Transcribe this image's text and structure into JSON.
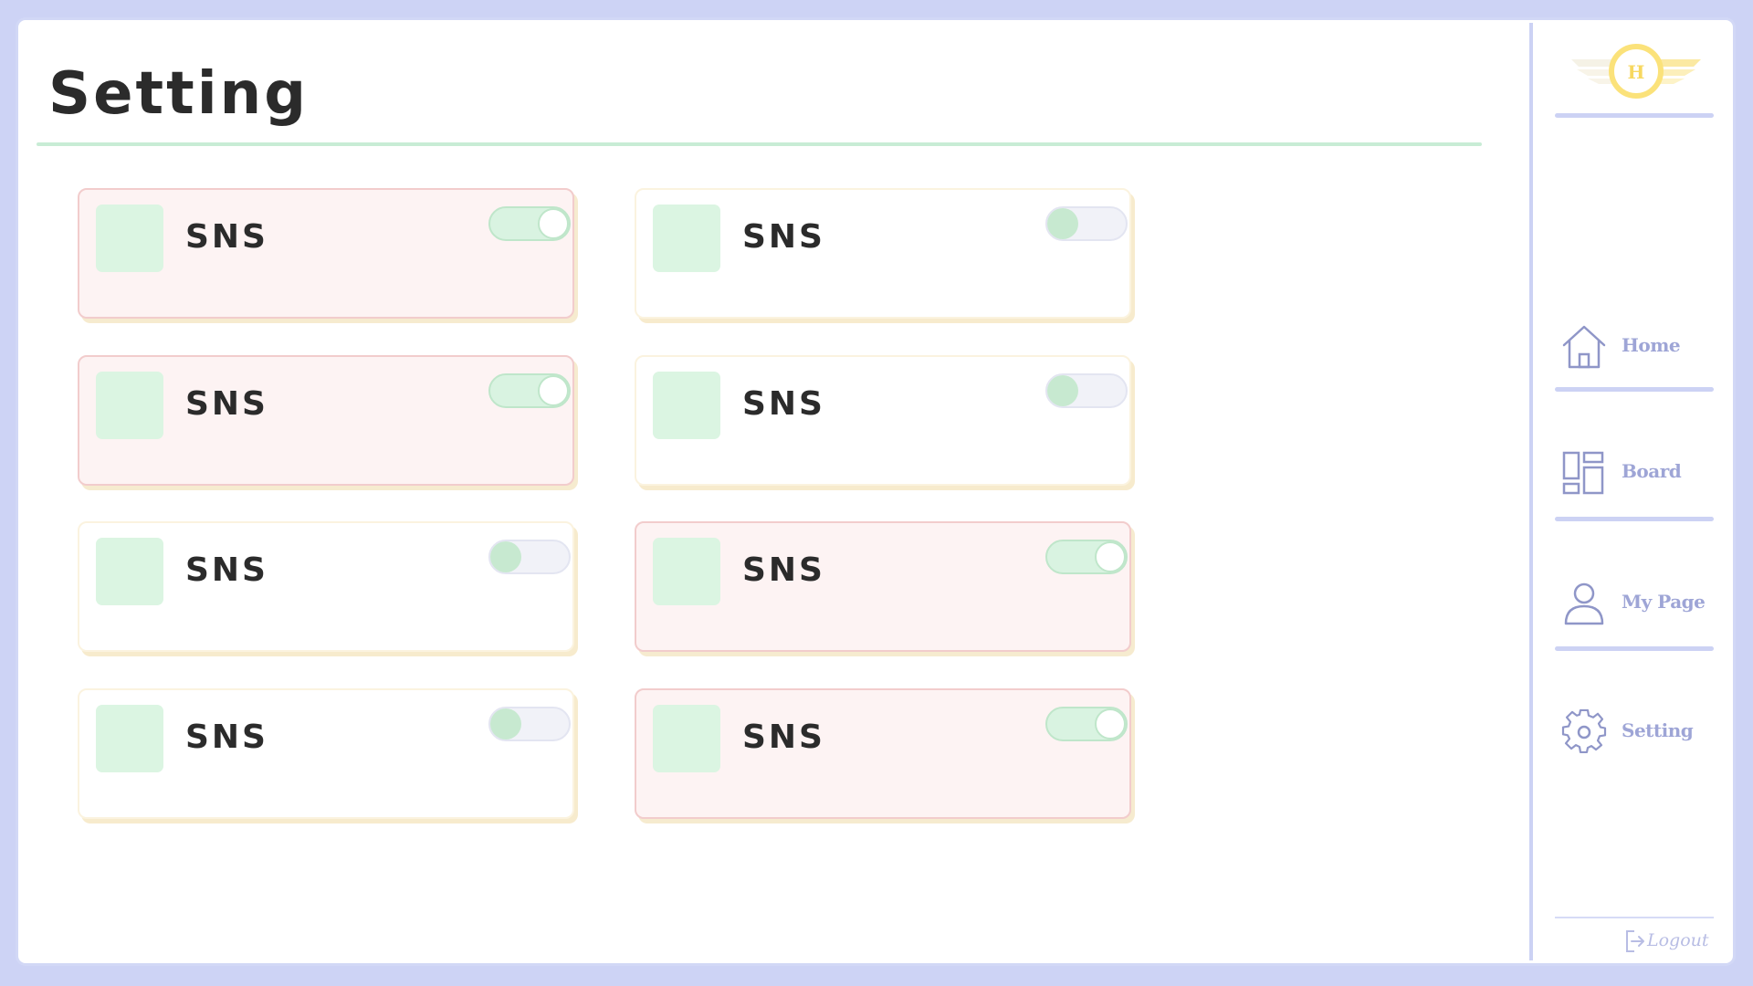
{
  "page": {
    "title": "Setting"
  },
  "colors": {
    "background": "#cdd3f5",
    "accent_green": "#c8ecd5",
    "card_on_bg": "#fdf3f3",
    "nav_text": "#9ea5d6",
    "logo_yellow": "#fbe27a"
  },
  "settings": {
    "items": [
      {
        "label": "SNS",
        "enabled": true
      },
      {
        "label": "SNS",
        "enabled": false
      },
      {
        "label": "SNS",
        "enabled": true
      },
      {
        "label": "SNS",
        "enabled": false
      },
      {
        "label": "SNS",
        "enabled": false
      },
      {
        "label": "SNS",
        "enabled": true
      },
      {
        "label": "SNS",
        "enabled": false
      },
      {
        "label": "SNS",
        "enabled": true
      }
    ]
  },
  "sidebar": {
    "logo_letter": "H",
    "items": [
      {
        "label": "Home",
        "icon": "home-icon"
      },
      {
        "label": "Board",
        "icon": "board-icon"
      },
      {
        "label": "My Page",
        "icon": "user-icon"
      },
      {
        "label": "Setting",
        "icon": "gear-icon"
      }
    ],
    "logout_label": "Logout",
    "logout_icon": "logout-icon"
  }
}
